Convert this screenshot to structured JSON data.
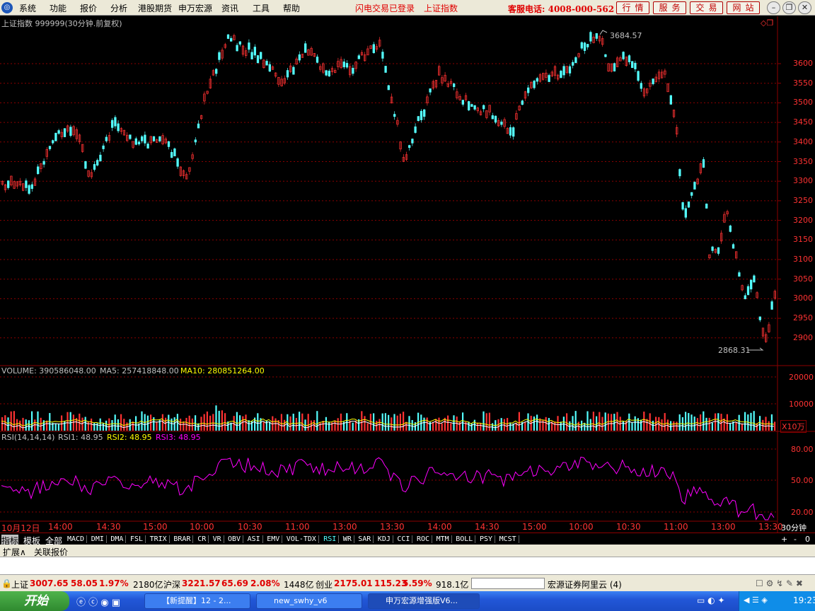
{
  "menu": {
    "items": [
      "系统",
      "功能",
      "报价",
      "分析",
      "港股期货",
      "申万宏源",
      "资讯",
      "工具",
      "帮助"
    ],
    "notice1": "闪电交易已登录",
    "notice2": "上证指数",
    "hotline": "客服电话: 4008-000-562",
    "nav": [
      "行情",
      "服务",
      "交易",
      "网站"
    ]
  },
  "chart": {
    "title": "上证指数 999999(30分钟.前复权)",
    "price_ticks": [
      "3600",
      "3550",
      "3500",
      "3450",
      "3400",
      "3350",
      "3300",
      "3250",
      "3200",
      "3150",
      "3100",
      "3050",
      "3000",
      "2950",
      "2900"
    ],
    "high_label": "3684.57",
    "low_label": "2868.31",
    "volume_label": "VOLUME: 390586048.00",
    "ma5_label": "MA5: 257418848.00",
    "ma10_label": "MA10: 280851264.00",
    "volume_ticks": [
      "20000",
      "10000"
    ],
    "volume_unit": "X10万",
    "rsi_label": "RSI(14,14,14)",
    "rsi1_label": "RSI1: 48.95",
    "rsi2_label": "RSI2: 48.95",
    "rsi3_label": "RSI3: 48.95",
    "rsi_ticks": [
      "80.00",
      "50.00",
      "20.00"
    ],
    "time_labels": [
      "10月12日",
      "14:00",
      "14:30",
      "15:00",
      "10:00",
      "10:30",
      "11:00",
      "13:00",
      "13:30",
      "14:00",
      "14:30",
      "15:00",
      "10:00",
      "10:30",
      "11:00",
      "13:00",
      "13:30"
    ],
    "period": "30分钟"
  },
  "tabs": {
    "side": [
      "指标",
      "模板",
      "全部"
    ],
    "indicators": [
      "MACD",
      "DMI",
      "DMA",
      "FSL",
      "TRIX",
      "BRAR",
      "CR",
      "VR",
      "OBV",
      "ASI",
      "EMV",
      "VOL-TDX",
      "RSI",
      "WR",
      "SAR",
      "KDJ",
      "CCI",
      "ROC",
      "MTM",
      "BOLL",
      "PSY",
      "MCST"
    ],
    "active": "RSI",
    "sub": [
      "扩展∧",
      "关联报价"
    ],
    "ctrl": [
      "+",
      "-",
      "0"
    ]
  },
  "status": {
    "sh_name": "上证",
    "sh_price": "3007.65",
    "sh_chg": "58.05",
    "sh_pct": "1.97%",
    "sh_amt": "2180亿",
    "hs_name": "沪深",
    "hs_price": "3221.57",
    "hs_chg": "65.69",
    "hs_pct": "2.08%",
    "hs_amt": "1448亿",
    "cy_name": "创业",
    "cy_price": "2175.01",
    "cy_chg": "115.23",
    "cy_pct": "5.59%",
    "cy_amt": "918.1亿",
    "broker": "宏源证券阿里云 (4)"
  },
  "taskbar": {
    "start": "开始",
    "tasks": [
      "【新提醒】12 - 2...",
      "new_swhy_v6",
      "申万宏源增强版V6..."
    ],
    "clock": "19:23"
  },
  "colors": {
    "up": "#ff3232",
    "down": "#54ffff",
    "grid": "#8b0000",
    "rsi": "#ff00ff",
    "ma10": "#ffff00"
  }
}
